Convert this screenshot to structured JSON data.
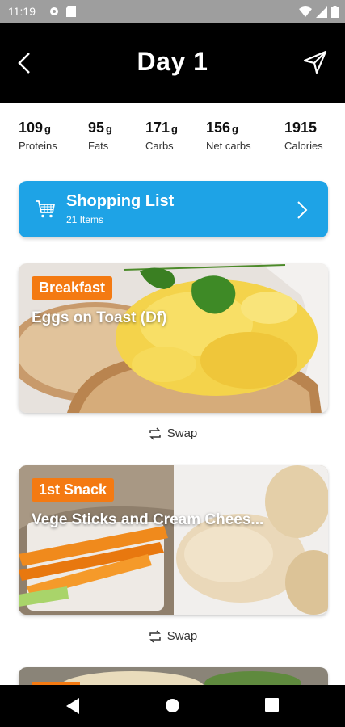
{
  "status": {
    "time": "11:19"
  },
  "header": {
    "title": "Day 1"
  },
  "macros": [
    {
      "value": "109",
      "unit": "g",
      "label": "Proteins"
    },
    {
      "value": "95",
      "unit": "g",
      "label": "Fats"
    },
    {
      "value": "171",
      "unit": "g",
      "label": "Carbs"
    },
    {
      "value": "156",
      "unit": "g",
      "label": "Net carbs"
    },
    {
      "value": "1915",
      "unit": "",
      "label": "Calories"
    }
  ],
  "shopping": {
    "title": "Shopping List",
    "subtitle": "21 Items"
  },
  "meals": [
    {
      "tag": "Breakfast",
      "name": "Eggs on Toast (Df)",
      "swap": "Swap"
    },
    {
      "tag": "1st Snack",
      "name": "Vege Sticks and Cream Chees...",
      "swap": "Swap"
    }
  ],
  "colors": {
    "accent": "#1ea3e6",
    "tag": "#f47a12",
    "header": "#000000"
  }
}
